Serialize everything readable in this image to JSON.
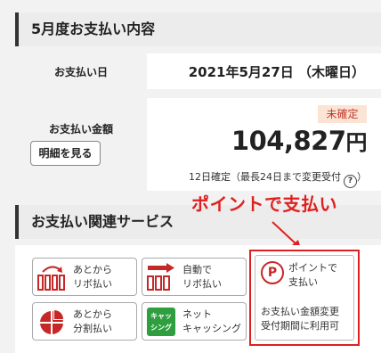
{
  "payment_section": {
    "title": "5月度お支払い内容",
    "date_label": "お支払い日",
    "date_value": "2021年5月27日 （木曜日）",
    "amount_label": "お支払い金額",
    "status_badge": "未確定",
    "amount_value": "104,827",
    "amount_unit": "円",
    "detail_button": "明細を見る",
    "confirm_note": "12日確定（最長24日まで変更受付",
    "confirm_note_end": "）",
    "help_icon_glyph": "?"
  },
  "annotation": {
    "text": "ポイントで支払い",
    "color": "#e02020"
  },
  "services": {
    "title": "お支払い関連サービス",
    "items": [
      {
        "line1": "あとから",
        "line2": "リボ払い",
        "icon": "revolving-later-icon"
      },
      {
        "line1": "自動で",
        "line2": "リボ払い",
        "icon": "auto-revolving-icon"
      },
      {
        "line1": "あとから",
        "line2": "分割払い",
        "icon": "installment-pie-icon"
      },
      {
        "line1": "ネット",
        "line2": "キャッシング",
        "icon": "cashing-icon",
        "icon_text1": "キャッ",
        "icon_text2": "シング"
      }
    ],
    "point_service": {
      "icon": "point-p-icon",
      "icon_glyph": "P",
      "title1": "ポイントで",
      "title2": "支払い",
      "desc1": "お支払い金額変更",
      "desc2": "受付期間に利用可"
    }
  },
  "colors": {
    "accent_red": "#c62828",
    "badge_bg": "#fbe4d4"
  }
}
